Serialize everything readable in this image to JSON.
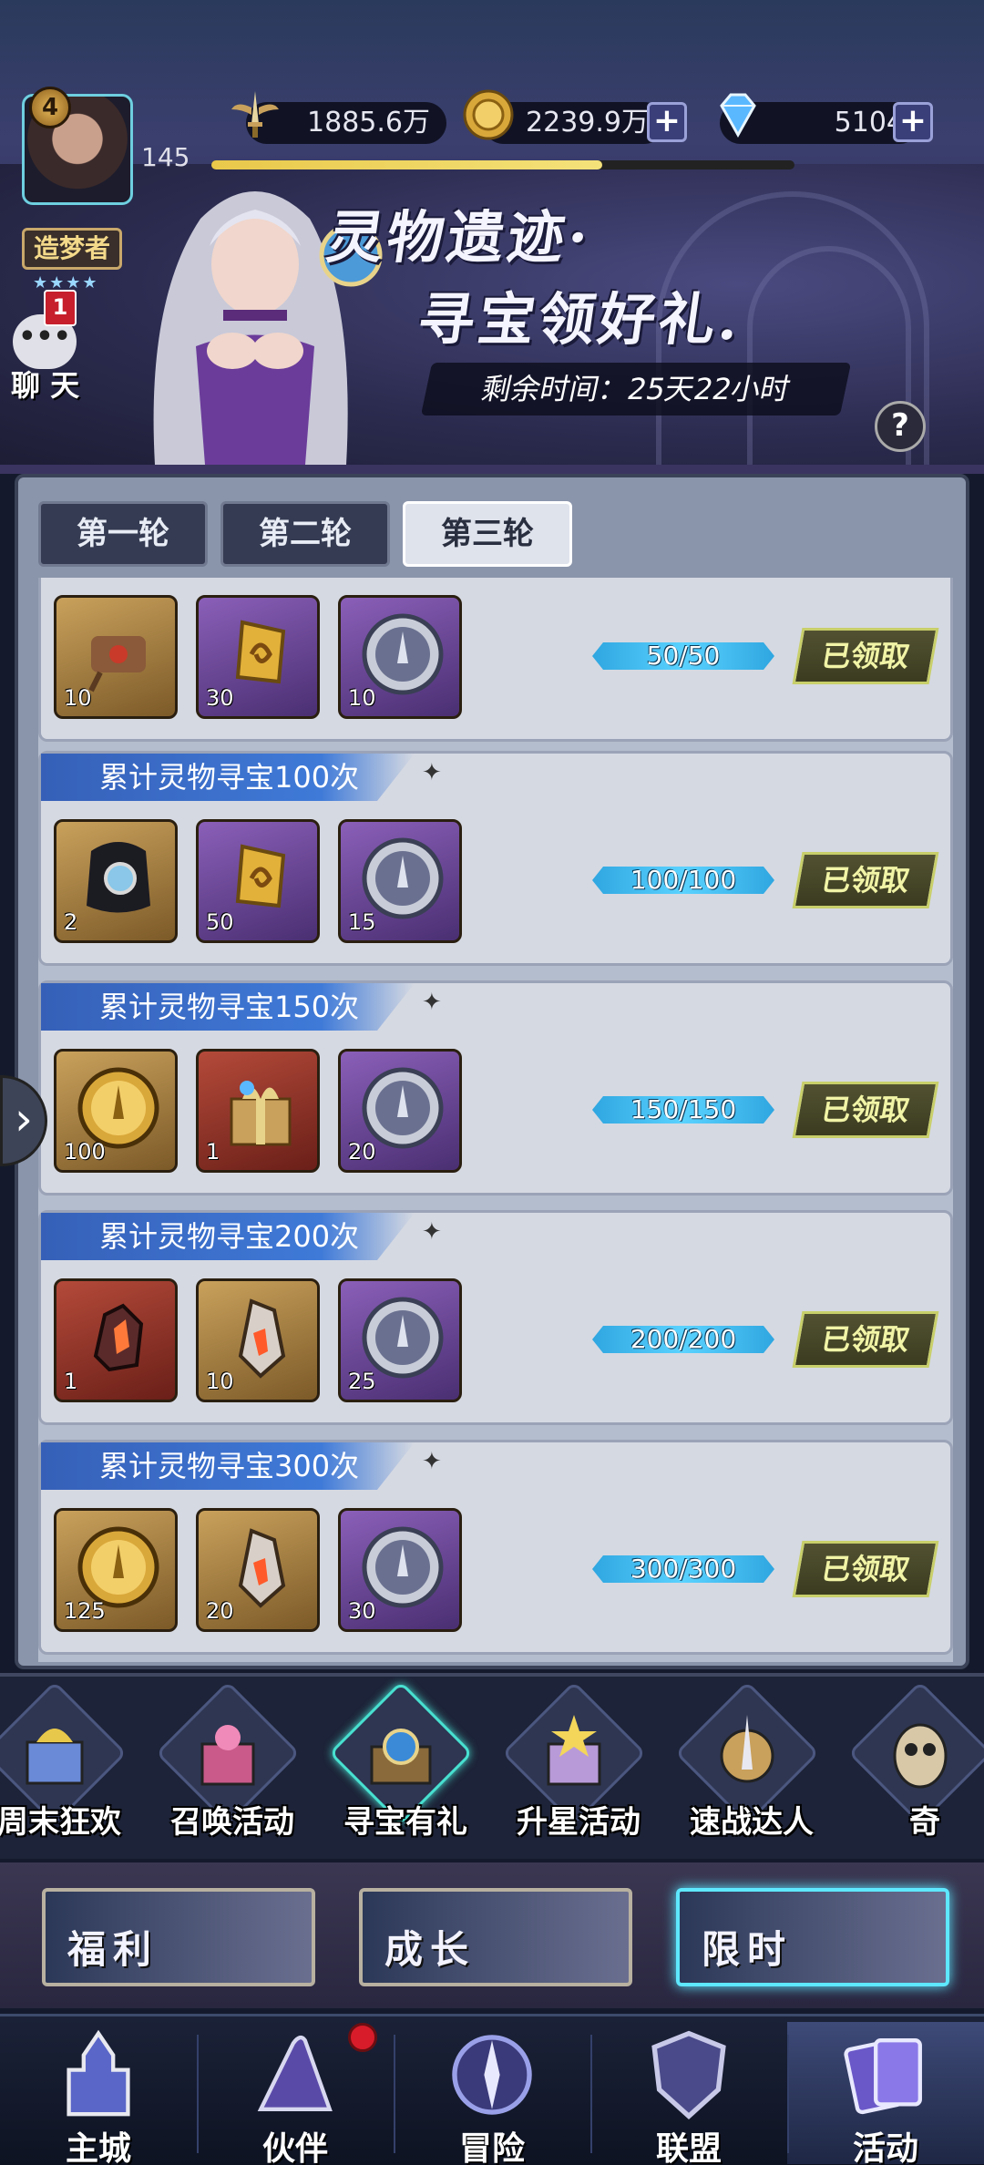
{
  "header": {
    "player_level": "4",
    "exp_value": "145",
    "exp_fraction": 0.67,
    "rank_title": "造梦者",
    "stars": "★★★★",
    "chat_unread": "1",
    "chat_label": "聊 天",
    "resources": {
      "power": "1885.6万",
      "gold": "2239.9万",
      "diamond": "5104"
    }
  },
  "banner": {
    "title_line1": "灵物遗迹·",
    "title_line2": "寻宝领好礼.",
    "timer": "剩余时间：25天22小时",
    "help": "?"
  },
  "tabs": [
    "第一轮",
    "第二轮",
    "第三轮"
  ],
  "active_tab": 2,
  "rows": [
    {
      "title": "",
      "items": [
        {
          "icon": "scroll-icon",
          "count": "10",
          "frame": "gold"
        },
        {
          "icon": "gold-rune-icon",
          "count": "30",
          "frame": "purple"
        },
        {
          "icon": "silver-coin-icon",
          "count": "10",
          "frame": "purple"
        }
      ],
      "progress": "50/50",
      "status": "已领取"
    },
    {
      "title": "累计灵物寻宝100次",
      "items": [
        {
          "icon": "magnifier-icon",
          "count": "2",
          "frame": "gold"
        },
        {
          "icon": "gold-rune-icon",
          "count": "50",
          "frame": "purple"
        },
        {
          "icon": "silver-coin-icon",
          "count": "15",
          "frame": "purple"
        }
      ],
      "progress": "100/100",
      "status": "已领取"
    },
    {
      "title": "累计灵物寻宝150次",
      "items": [
        {
          "icon": "gold-coin-icon",
          "count": "100",
          "frame": "gold"
        },
        {
          "icon": "gift-box-icon",
          "count": "1",
          "frame": "red"
        },
        {
          "icon": "silver-coin-icon",
          "count": "20",
          "frame": "purple"
        }
      ],
      "progress": "150/150",
      "status": "已领取"
    },
    {
      "title": "累计灵物寻宝200次",
      "items": [
        {
          "icon": "red-crystal-icon",
          "count": "1",
          "frame": "red"
        },
        {
          "icon": "crystal-shard-icon",
          "count": "10",
          "frame": "gold"
        },
        {
          "icon": "silver-coin-icon",
          "count": "25",
          "frame": "purple"
        }
      ],
      "progress": "200/200",
      "status": "已领取"
    },
    {
      "title": "累计灵物寻宝300次",
      "items": [
        {
          "icon": "gold-coin-icon",
          "count": "125",
          "frame": "gold"
        },
        {
          "icon": "crystal-shard-icon",
          "count": "20",
          "frame": "gold"
        },
        {
          "icon": "silver-coin-icon",
          "count": "30",
          "frame": "purple"
        }
      ],
      "progress": "300/300",
      "status": "已领取"
    }
  ],
  "events": [
    {
      "label": "周末狂欢",
      "icon": "weekend-gift-icon"
    },
    {
      "label": "召唤活动",
      "icon": "summon-gift-icon"
    },
    {
      "label": "寻宝有礼",
      "icon": "treasure-chest-icon"
    },
    {
      "label": "升星活动",
      "icon": "star-gift-icon"
    },
    {
      "label": "速战达人",
      "icon": "sword-emblem-icon"
    },
    {
      "label": "奇",
      "icon": "owl-icon"
    }
  ],
  "active_event": 2,
  "categories": [
    "福利",
    "成长",
    "限时"
  ],
  "active_category": 2,
  "nav": [
    {
      "label": "主城",
      "icon": "castle-icon"
    },
    {
      "label": "伙伴",
      "icon": "wizard-hat-icon"
    },
    {
      "label": "冒险",
      "icon": "compass-icon"
    },
    {
      "label": "联盟",
      "icon": "shield-icon"
    },
    {
      "label": "活动",
      "icon": "cards-icon"
    }
  ],
  "active_nav": 4,
  "colors": {
    "progress": "#3fb8ee",
    "claimed_border": "#c8cf6a",
    "active_glow": "#5ee8ff",
    "notify_dot": "#d81c2a"
  }
}
